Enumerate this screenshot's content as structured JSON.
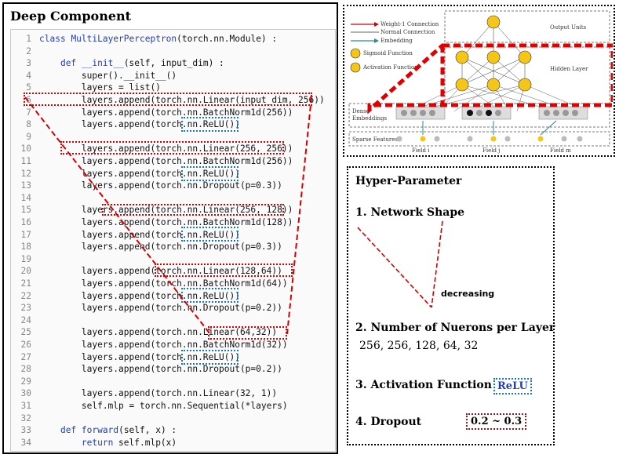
{
  "left_panel": {
    "title": "Deep Component",
    "code_lines": [
      {
        "n": "1",
        "segs": [
          [
            "class",
            "kw"
          ],
          [
            " ",
            ""
          ],
          [
            "MultiLayerPerceptron",
            "fn"
          ],
          [
            "(torch.nn.Module) :",
            ""
          ]
        ]
      },
      {
        "n": "2",
        "segs": []
      },
      {
        "n": "3",
        "segs": [
          [
            "    ",
            ""
          ],
          [
            "def",
            "kw"
          ],
          [
            " ",
            ""
          ],
          [
            "__init__",
            "fn"
          ],
          [
            "(self, input_dim) :",
            ""
          ]
        ]
      },
      {
        "n": "4",
        "segs": [
          [
            "        super().__init__()",
            ""
          ]
        ]
      },
      {
        "n": "5",
        "segs": [
          [
            "        layers = list()",
            ""
          ]
        ]
      },
      {
        "n": "6",
        "segs": [
          [
            "        layers.append(torch.nn.Linear(input_dim, 256))",
            ""
          ]
        ]
      },
      {
        "n": "7",
        "segs": [
          [
            "        layers.append(torch.nn.BatchNorm1d(256))",
            ""
          ]
        ]
      },
      {
        "n": "8",
        "segs": [
          [
            "        layers.append(torch.nn.ReLU())",
            ""
          ]
        ]
      },
      {
        "n": "9",
        "segs": []
      },
      {
        "n": "10",
        "segs": [
          [
            "        layers.append(torch.nn.Linear(256, 256))",
            ""
          ]
        ]
      },
      {
        "n": "11",
        "segs": [
          [
            "        layers.append(torch.nn.BatchNorm1d(256))",
            ""
          ]
        ]
      },
      {
        "n": "12",
        "segs": [
          [
            "        layers.append(torch.nn.ReLU())",
            ""
          ]
        ]
      },
      {
        "n": "13",
        "segs": [
          [
            "        layers.append(torch.nn.Dropout(p=0.3))",
            ""
          ]
        ]
      },
      {
        "n": "14",
        "segs": []
      },
      {
        "n": "15",
        "segs": [
          [
            "        layers.append(torch.nn.Linear(256, 128))",
            ""
          ]
        ]
      },
      {
        "n": "16",
        "segs": [
          [
            "        layers.append(torch.nn.BatchNorm1d(128))",
            ""
          ]
        ]
      },
      {
        "n": "17",
        "segs": [
          [
            "        layers.append(torch.nn.ReLU())",
            ""
          ]
        ]
      },
      {
        "n": "18",
        "segs": [
          [
            "        layers.append(torch.nn.Dropout(p=0.3))",
            ""
          ]
        ]
      },
      {
        "n": "19",
        "segs": []
      },
      {
        "n": "20",
        "segs": [
          [
            "        layers.append(torch.nn.Linear(128,64))",
            ""
          ]
        ]
      },
      {
        "n": "21",
        "segs": [
          [
            "        layers.append(torch.nn.BatchNorm1d(64))",
            ""
          ]
        ]
      },
      {
        "n": "22",
        "segs": [
          [
            "        layers.append(torch.nn.ReLU())",
            ""
          ]
        ]
      },
      {
        "n": "23",
        "segs": [
          [
            "        layers.append(torch.nn.Dropout(p=0.2))",
            ""
          ]
        ]
      },
      {
        "n": "24",
        "segs": []
      },
      {
        "n": "25",
        "segs": [
          [
            "        layers.append(torch.nn.Linear(64,32))",
            ""
          ]
        ]
      },
      {
        "n": "26",
        "segs": [
          [
            "        layers.append(torch.nn.BatchNorm1d(32))",
            ""
          ]
        ]
      },
      {
        "n": "27",
        "segs": [
          [
            "        layers.append(torch.nn.ReLU())",
            ""
          ]
        ]
      },
      {
        "n": "28",
        "segs": [
          [
            "        layers.append(torch.nn.Dropout(p=0.2))",
            ""
          ]
        ]
      },
      {
        "n": "29",
        "segs": []
      },
      {
        "n": "30",
        "segs": [
          [
            "        layers.append(torch.nn.Linear(32, 1))",
            ""
          ]
        ]
      },
      {
        "n": "31",
        "segs": [
          [
            "        self.mlp = torch.nn.Sequential(*layers)",
            ""
          ]
        ]
      },
      {
        "n": "32",
        "segs": []
      },
      {
        "n": "33",
        "segs": [
          [
            "    ",
            ""
          ],
          [
            "def",
            "kw"
          ],
          [
            " ",
            ""
          ],
          [
            "forward",
            "fn"
          ],
          [
            "(self, x) :",
            ""
          ]
        ]
      },
      {
        "n": "34",
        "segs": [
          [
            "        ",
            ""
          ],
          [
            "return",
            "kw"
          ],
          [
            " self.mlp(x)",
            ""
          ]
        ]
      }
    ]
  },
  "network_diagram": {
    "legend": {
      "weight_connection": "Weight-1 Connection",
      "normal_connection": "Normal Connection",
      "embedding": "Embedding",
      "sigmoid": "Sigmoid Function",
      "activation": "Activation Function"
    },
    "output_units_label": "Output Units",
    "hidden_layer_label": "Hidden Layer",
    "dense_embeddings_label": "Dense\nEmbeddings",
    "sparse_features_label": "Sparse Features",
    "field_labels": [
      "Field i",
      "Field j",
      "Field m"
    ]
  },
  "hyper_parameter": {
    "title": "Hyper-Parameter",
    "item1": "1.  Network Shape",
    "decreasing_label": "decreasing",
    "item2": "2.  Number of Nuerons per Layer",
    "neurons": "256, 256, 128, 64, 32",
    "item3": "3.  Activation Function",
    "activation_value": "ReLU",
    "item4": "4.  Dropout",
    "dropout_value": "0.2 ~ 0.3"
  },
  "colors": {
    "red_dotted": "#d40000",
    "blue_dotted": "#1b75bb",
    "unit_yellow": "#f5c518",
    "keyword_blue": "#1f3fb8"
  }
}
